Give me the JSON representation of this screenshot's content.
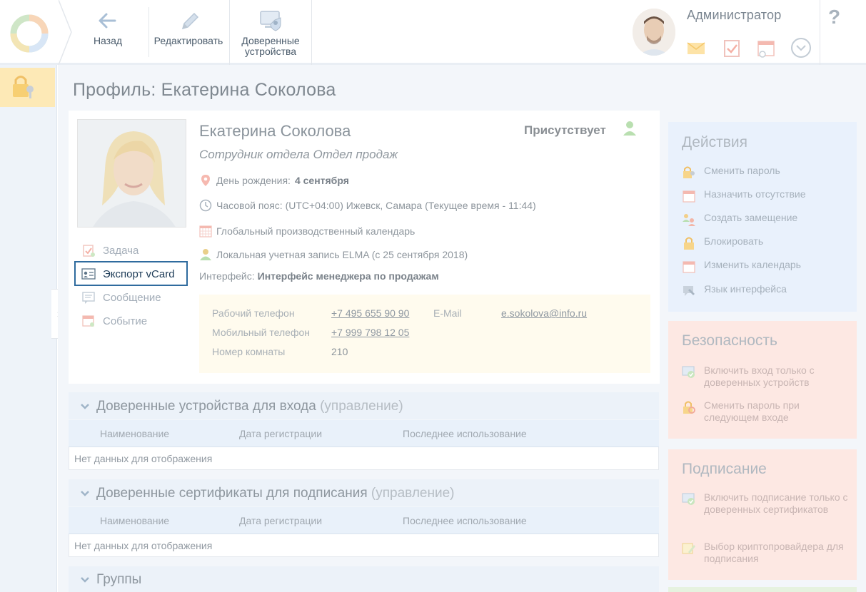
{
  "toolbar": {
    "back_label": "Назад",
    "edit_label": "Редактировать",
    "trusted_label_1": "Доверенные",
    "trusted_label_2": "устройства"
  },
  "user": {
    "name": "Администратор"
  },
  "help_label": "?",
  "page": {
    "title": "Профиль: Екатерина Соколова"
  },
  "profile": {
    "name": "Екатерина Соколова",
    "status": "Присутствует",
    "position": "Сотрудник отдела Отдел продаж",
    "birthday_label": "День рождения:",
    "birthday_value": "4 сентября",
    "timezone": "Часовой пояс: (UTC+04:00) Ижевск, Самара (Текущее время - 11:44)",
    "calendar": "Глобальный производственный календарь",
    "account": "Локальная учетная запись ELMA  (с 25 сентября 2018)",
    "interface_label": "Интерфейс:",
    "interface_value": "Интерфейс менеджера по продажам"
  },
  "side_actions": {
    "task": "Задача",
    "vcard": "Экспорт vCard",
    "message": "Сообщение",
    "event": "Событие"
  },
  "contacts": {
    "work_phone_label": "Рабочий телефон",
    "work_phone": "+7 495 655 90 90",
    "mobile_label": "Мобильный телефон",
    "mobile": "+7 999 798 12 05",
    "room_label": "Номер комнаты",
    "room": "210",
    "email_label": "E-Mail",
    "email": "e.sokolova@info.ru"
  },
  "sections": {
    "devices": {
      "title": "Доверенные устройства для входа",
      "manage": "(управление)",
      "columns": [
        "Наименование",
        "Дата регистрации",
        "Последнее использование"
      ],
      "empty": "Нет данных для отображения"
    },
    "certs": {
      "title": "Доверенные сертификаты для подписания",
      "manage": "(управление)",
      "columns": [
        "Наименование",
        "Дата регистрации",
        "Последнее использование"
      ],
      "empty": "Нет данных для отображения"
    },
    "groups": {
      "title": "Группы"
    }
  },
  "panels": {
    "actions": {
      "title": "Действия",
      "items": [
        "Сменить пароль",
        "Назначить отсутствие",
        "Создать замещение",
        "Блокировать",
        "Изменить календарь",
        "Язык интерфейса"
      ]
    },
    "security": {
      "title": "Безопасность",
      "items": [
        "Включить вход только с доверенных устройств",
        "Сменить пароль при следующем входе"
      ]
    },
    "signing": {
      "title": "Подписание",
      "items": [
        "Включить подписание только с доверенных сертификатов",
        "Выбор криптопровайдера для подписания"
      ]
    }
  }
}
